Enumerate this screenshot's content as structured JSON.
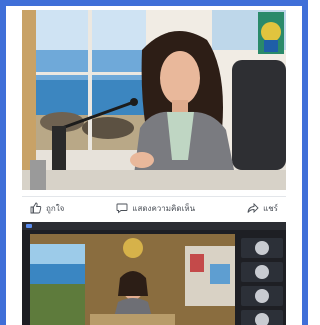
{
  "post_actions": {
    "like_label": "ถูกใจ",
    "comment_label": "แสดงความคิดเห็น",
    "share_label": "แชร์"
  },
  "colors": {
    "frame_blue": "#3f6fd8",
    "action_text": "#4a4f57",
    "vc_background": "#1e1f24"
  },
  "icons": [
    "thumbs-up-icon",
    "comment-bubble-icon",
    "share-arrow-icon"
  ]
}
